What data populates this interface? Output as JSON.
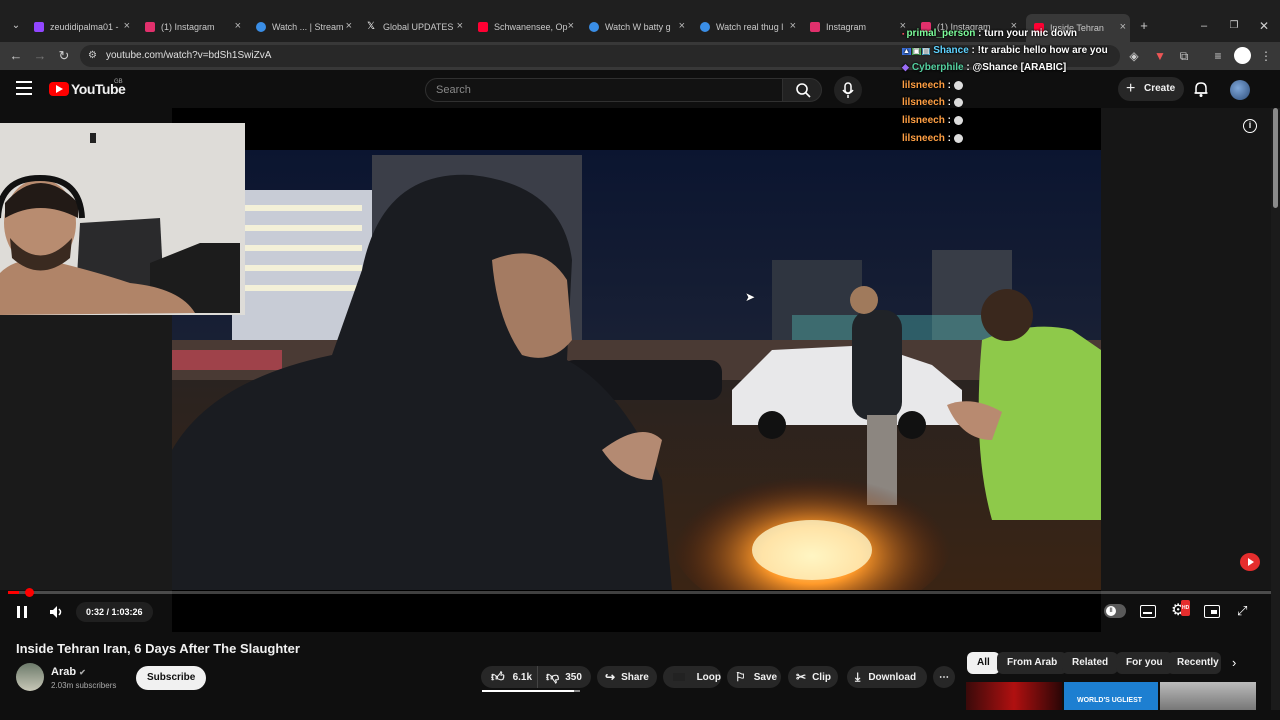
{
  "browser": {
    "tabs": [
      {
        "label": "zeudidipalma01 -",
        "color": "#9146ff"
      },
      {
        "label": "(1) Instagram",
        "color": "#e1306c"
      },
      {
        "label": "Watch ... | Stream",
        "color": "#3a8ee6"
      },
      {
        "label": "Global UPDATES",
        "color": "#ffffff"
      },
      {
        "label": "Schwanensee, Op",
        "color": "#ff0033"
      },
      {
        "label": "Watch W batty g",
        "color": "#3a8ee6"
      },
      {
        "label": "Watch real thug l",
        "color": "#3a8ee6"
      },
      {
        "label": "Instagram",
        "color": "#e1306c"
      },
      {
        "label": "(1) Instagram",
        "color": "#e1306c"
      },
      {
        "label": "Inside Tehran",
        "color": "#ff0033"
      }
    ],
    "new_tab": "+",
    "url": "youtube.com/watch?v=bdSh1SwiZvA"
  },
  "youtube": {
    "logo": "YouTube",
    "region": "GB",
    "search_placeholder": "Search",
    "create_label": "Create"
  },
  "chat": [
    {
      "user": "primal_person",
      "sep": " : ",
      "text": "turn your mic down",
      "color": "#7cfc9a"
    },
    {
      "user": "Shance",
      "sep": " : ",
      "text": "!tr arabic hello how are you",
      "color": "#5fd3ff"
    },
    {
      "user": "Cyberphile",
      "sep": " : ",
      "text": "@Shance [ARABIC]",
      "color": "#54d1a0"
    },
    {
      "user": "lilsneech",
      "sep": " : ",
      "text": "",
      "color": "#ff9f43"
    },
    {
      "user": "lilsneech",
      "sep": " : ",
      "text": "",
      "color": "#ff9f43"
    },
    {
      "user": "lilsneech",
      "sep": " : ",
      "text": "",
      "color": "#ff9f43"
    },
    {
      "user": "lilsneech",
      "sep": " : ",
      "text": "",
      "color": "#ff9f43"
    }
  ],
  "player": {
    "time": "0:32 / 1:03:26",
    "progress": 0.0084
  },
  "video_info": {
    "title": "Inside Tehran Iran, 6 Days After The Slaughter",
    "channel": "Arab",
    "subscribers": "2.03m subscribers",
    "subscribe_label": "Subscribe",
    "likes": "6.1k",
    "dislikes": "350",
    "share": "Share",
    "loop": "Loop",
    "save": "Save",
    "clip": "Clip",
    "download": "Download"
  },
  "chips": [
    "All",
    "From Arab",
    "Related",
    "For you",
    "Recently u"
  ],
  "thumbnail_text": "WORLD'S UGLIEST"
}
